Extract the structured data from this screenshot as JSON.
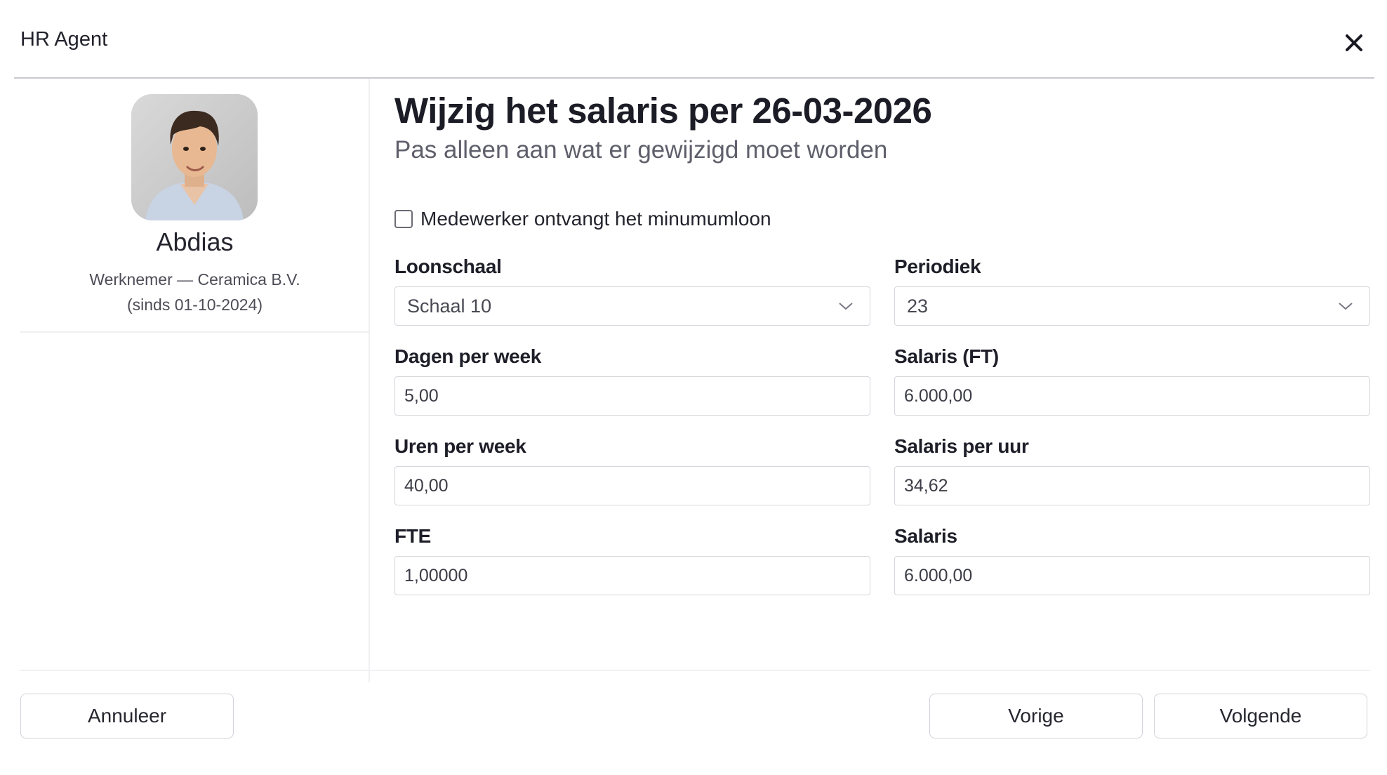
{
  "header": {
    "app_title": "HR Agent",
    "close_icon": "close-icon"
  },
  "employee": {
    "name": "Abdias",
    "role_line": "Werknemer — Ceramica B.V.",
    "since_line": "(sinds 01-10-2024)",
    "avatar_icon": "avatar-photo"
  },
  "form": {
    "title": "Wijzig het salaris per 26-03-2026",
    "subtitle": "Pas alleen aan wat er gewijzigd moet worden",
    "minimum_wage": {
      "label": "Medewerker ontvangt het minumumloon",
      "checked": false
    },
    "loonschaal": {
      "label": "Loonschaal",
      "value": "Schaal 10"
    },
    "periodiek": {
      "label": "Periodiek",
      "value": "23"
    },
    "dagen_per_week": {
      "label": "Dagen per week",
      "value": "5,00"
    },
    "salaris_ft": {
      "label": "Salaris (FT)",
      "value": "6.000,00"
    },
    "uren_per_week": {
      "label": "Uren per week",
      "value": "40,00"
    },
    "salaris_per_uur": {
      "label": "Salaris per uur",
      "value": "34,62"
    },
    "fte": {
      "label": "FTE",
      "value": "1,00000"
    },
    "salaris": {
      "label": "Salaris",
      "value": "6.000,00"
    }
  },
  "footer": {
    "cancel_label": "Annuleer",
    "previous_label": "Vorige",
    "next_label": "Volgende"
  }
}
